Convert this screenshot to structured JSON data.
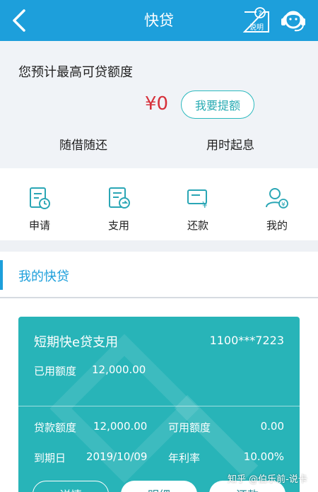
{
  "header": {
    "title": "快贷",
    "help_label": "说明"
  },
  "quota": {
    "title": "您预计最高可贷额度",
    "amount": "¥0",
    "raise_button": "我要提额",
    "features": [
      "随借随还",
      "用时起息"
    ]
  },
  "menu": [
    {
      "label": "申请",
      "icon": "application-form-icon"
    },
    {
      "label": "支用",
      "icon": "withdraw-document-icon"
    },
    {
      "label": "还款",
      "icon": "repayment-icon"
    },
    {
      "label": "我的",
      "icon": "user-profile-icon"
    }
  ],
  "section": {
    "title": "我的快贷"
  },
  "loan_card": {
    "product_name": "短期快e贷支用",
    "card_number": "1100***7223",
    "used_label": "已用额度",
    "used_value": "12,000.00",
    "loan_amount_label": "贷款额度",
    "loan_amount_value": "12,000.00",
    "available_label": "可用额度",
    "available_value": "0.00",
    "due_date_label": "到期日",
    "due_date_value": "2019/10/09",
    "rate_label": "年利率",
    "rate_value": "10.00%",
    "buttons": [
      "详情",
      "明细",
      "还款"
    ]
  },
  "watermark": "知乎 @伯乐前-说卡",
  "colors": {
    "header": "#1d9fdb",
    "card": "#28b4b8",
    "amount": "#d6303a",
    "accent": "#2bb9be"
  }
}
